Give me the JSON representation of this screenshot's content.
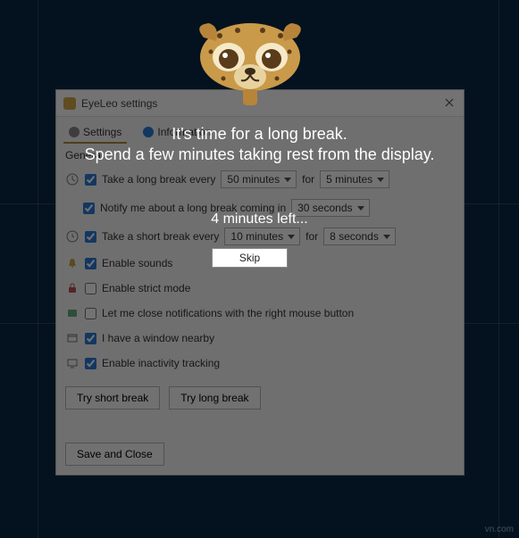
{
  "window": {
    "title": "EyeLeo settings",
    "tabs": {
      "settings": "Settings",
      "information": "Information"
    },
    "section_general": "General"
  },
  "rows": {
    "long_break_label": "Take a long break every",
    "long_break_interval": "50 minutes",
    "for_text": "for",
    "long_break_duration": "5 minutes",
    "notify_label": "Notify me about a long break coming in",
    "notify_value": "30 seconds",
    "short_break_label": "Take a short break every",
    "short_break_interval": "10 minutes",
    "short_break_duration": "8 seconds",
    "sounds_label": "Enable sounds",
    "strict_label": "Enable strict mode",
    "rmb_label": "Let me close notifications with the right mouse button",
    "window_nearby_label": "I have a window nearby",
    "inactivity_label": "Enable inactivity tracking"
  },
  "buttons": {
    "try_short": "Try short break",
    "try_long": "Try long break",
    "save_close": "Save and Close",
    "skip": "Skip"
  },
  "overlay": {
    "line1": "It's time for a long break.",
    "line2": "Spend a few minutes taking rest from the display.",
    "countdown": "4 minutes left..."
  },
  "watermark": "vn.com"
}
